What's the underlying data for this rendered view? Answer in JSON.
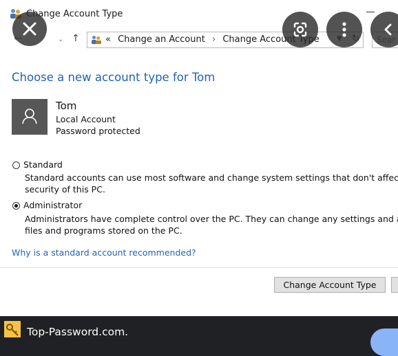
{
  "window": {
    "title": "Change Account Type",
    "icons": {
      "app": "control-panel-users-icon",
      "minimize": "minimize-icon"
    }
  },
  "address_bar": {
    "prefix": "«",
    "crumbs": [
      "Change an Account",
      "Change Account Type"
    ],
    "separator": "›",
    "search_placeholder": "Sear",
    "icons": {
      "back": "back-arrow-icon",
      "history": "chevron-down-icon",
      "up": "up-arrow-icon",
      "refresh": "refresh-icon"
    }
  },
  "main": {
    "heading": "Choose a new account type for Tom",
    "user": {
      "name": "Tom",
      "type": "Local Account",
      "status": "Password protected",
      "avatar_icon": "user-silhouette-icon"
    },
    "options": [
      {
        "label": "Standard",
        "checked": false,
        "description_line1": "Standard accounts can use most software and change system settings that don't affect other users or the",
        "description_line2": "security of this PC."
      },
      {
        "label": "Administrator",
        "checked": true,
        "description_line1": "Administrators have complete control over the PC. They can change any settings and access all of the",
        "description_line2": "files and programs stored on the PC."
      }
    ],
    "why_link": "Why is a standard account recommended?",
    "primary_button": "Change Account Type"
  },
  "overlay": {
    "close_icon": "close-icon",
    "lens_icon": "lens-search-icon",
    "more_icon": "more-vertical-icon",
    "back_icon": "chevron-left-icon"
  },
  "source": {
    "site": "Top-Password.com.",
    "favicon": "key-icon"
  },
  "colors": {
    "accent_blue": "#1e64b4",
    "avatar_bg": "#575757",
    "page_bg": "#202124"
  }
}
